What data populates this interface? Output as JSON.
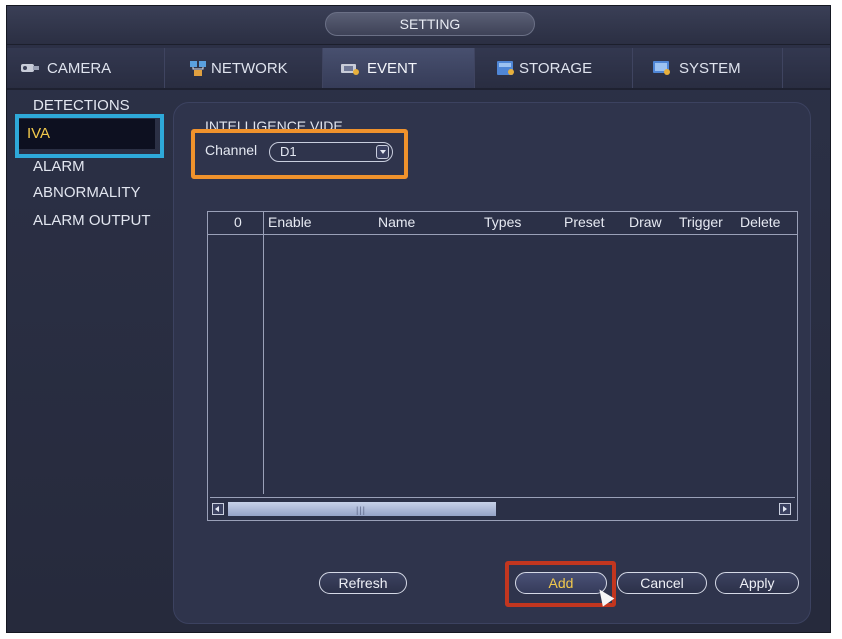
{
  "window": {
    "title": "SETTING"
  },
  "tabs": [
    {
      "label": "CAMERA",
      "icon": "camera-icon",
      "active": false
    },
    {
      "label": "NETWORK",
      "icon": "network-icon",
      "active": false
    },
    {
      "label": "EVENT",
      "icon": "event-icon",
      "active": true
    },
    {
      "label": "STORAGE",
      "icon": "storage-icon",
      "active": false
    },
    {
      "label": "SYSTEM",
      "icon": "system-icon",
      "active": false
    }
  ],
  "sidebar": {
    "items": [
      {
        "label": "DETECTIONS"
      },
      {
        "label": "IVA",
        "selected": true
      },
      {
        "label": "ALARM"
      },
      {
        "label": "ABNORMALITY"
      },
      {
        "label": "ALARM OUTPUT"
      }
    ]
  },
  "main": {
    "section_title": "INTELLIGENCE VIDE",
    "channel": {
      "label": "Channel",
      "value": "D1"
    },
    "table": {
      "columns": [
        "0",
        "Enable",
        "Name",
        "Types",
        "Preset",
        "Draw",
        "Trigger",
        "Delete"
      ],
      "rows": []
    },
    "scrollbar": {
      "grip": "|||"
    },
    "buttons": {
      "refresh": "Refresh",
      "add": "Add",
      "cancel": "Cancel",
      "apply": "Apply"
    }
  },
  "colors": {
    "accent_selected": "#f2c94c",
    "highlight_blue": "#2ea9d9",
    "highlight_orange": "#f0922c",
    "highlight_red": "#c2361f"
  }
}
